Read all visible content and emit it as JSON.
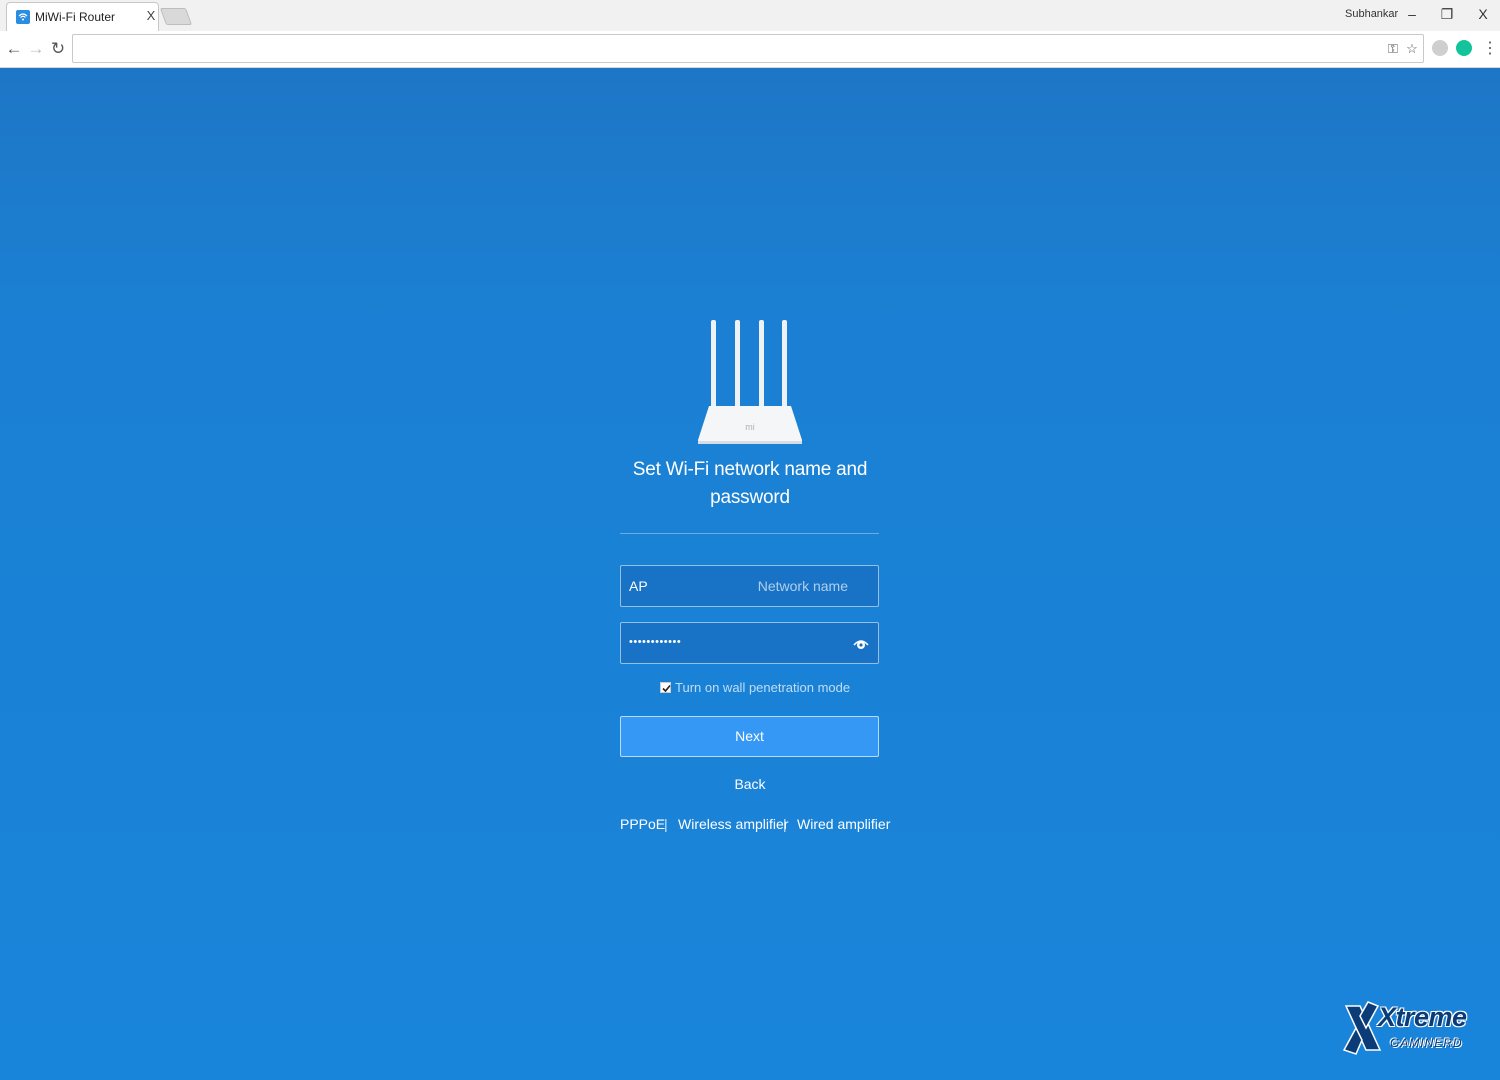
{
  "browser": {
    "tab_title": "MiWi-Fi Router",
    "tab_close": "X",
    "profile_name": "Subhankar",
    "window_buttons": {
      "minimize": "–",
      "restore": "❐",
      "close": "X"
    },
    "url": ""
  },
  "setup": {
    "heading_line1": "Set Wi-Fi network name and",
    "heading_line2": "password",
    "network_name_value": "AP",
    "network_name_placeholder": "Network name",
    "password_mask": "••••••••••••",
    "wall_penetration_label": "Turn on wall penetration mode",
    "wall_penetration_checked": true,
    "next_label": "Next",
    "back_label": "Back",
    "links": {
      "pppoe": "PPPoE",
      "separator": "|",
      "wireless_amplifier": "Wireless amplifier",
      "wired_amplifier": "Wired amplifier"
    },
    "router_logo": "mi"
  },
  "watermark": {
    "main": "Xtreme",
    "sub": "GAMINERD"
  },
  "colors": {
    "page_background": "#1985da",
    "button_background": "#3498f4"
  }
}
